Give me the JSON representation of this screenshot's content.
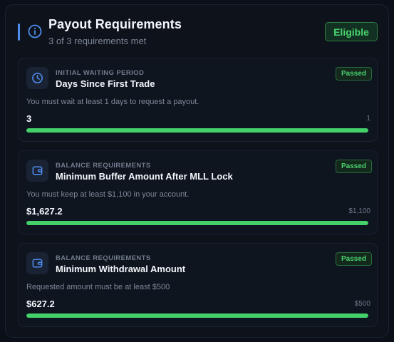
{
  "header": {
    "icon": "info-icon",
    "title": "Payout Requirements",
    "subtitle": "3 of 3 requirements met",
    "status_label": "Eligible"
  },
  "colors": {
    "accent": "#4d8df0",
    "success": "#44d16a",
    "background": "#0b0f17"
  },
  "requirements": [
    {
      "icon": "clock-icon",
      "category": "INITIAL WAITING PERIOD",
      "title": "Days Since First Trade",
      "status": "Passed",
      "description": "You must wait at least 1 days to request a payout.",
      "current": "3",
      "target": "1",
      "progress": 1.0
    },
    {
      "icon": "wallet-icon",
      "category": "BALANCE REQUIREMENTS",
      "title": "Minimum Buffer Amount After MLL Lock",
      "status": "Passed",
      "description": "You must keep at least $1,100 in your account.",
      "current": "$1,627.2",
      "target": "$1,100",
      "progress": 1.0
    },
    {
      "icon": "wallet-icon",
      "category": "BALANCE REQUIREMENTS",
      "title": "Minimum Withdrawal Amount",
      "status": "Passed",
      "description": "Requested amount must be at least $500",
      "current": "$627.2",
      "target": "$500",
      "progress": 1.0
    }
  ]
}
